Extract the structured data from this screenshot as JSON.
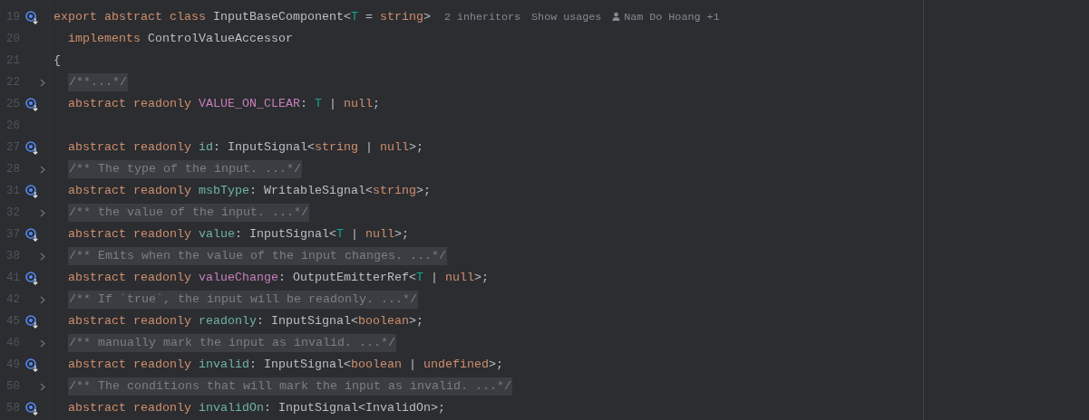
{
  "editor": {
    "lines": [
      {
        "number": "19",
        "marker": {
          "kind": "implemented"
        },
        "kind": "code",
        "indented": false,
        "tokens": [
          {
            "text": "export abstract class ",
            "kind": "kw"
          },
          {
            "text": "InputBaseComponent<",
            "kind": "plain"
          },
          {
            "text": "T",
            "kind": "tparam"
          },
          {
            "text": " = ",
            "kind": "plain"
          },
          {
            "text": "string",
            "kind": "kw"
          },
          {
            "text": ">",
            "kind": "plain"
          }
        ],
        "hints": [
          {
            "text": "2 inheritors",
            "kind": "text"
          },
          {
            "text": "Show usages",
            "kind": "link"
          },
          {
            "text": "Nam Do Hoang +1",
            "kind": "author"
          }
        ]
      },
      {
        "number": "20",
        "kind": "code",
        "indented": true,
        "tokens": [
          {
            "text": "implements ",
            "kind": "kw"
          },
          {
            "text": "ControlValueAccessor",
            "kind": "plain"
          }
        ]
      },
      {
        "number": "21",
        "kind": "code",
        "indented": false,
        "tokens": [
          {
            "text": "{",
            "kind": "plain"
          }
        ]
      },
      {
        "number": "22",
        "marker": {
          "kind": "fold"
        },
        "kind": "folded",
        "indented": true,
        "text": "/**...*/"
      },
      {
        "number": "25",
        "marker": {
          "kind": "implemented"
        },
        "kind": "code",
        "indented": true,
        "tokens": [
          {
            "text": "abstract readonly ",
            "kind": "kw"
          },
          {
            "text": "VALUE_ON_CLEAR",
            "kind": "field"
          },
          {
            "text": ": ",
            "kind": "plain"
          },
          {
            "text": "T",
            "kind": "tparam"
          },
          {
            "text": " | ",
            "kind": "plain"
          },
          {
            "text": "null",
            "kind": "kw"
          },
          {
            "text": ";",
            "kind": "plain"
          }
        ]
      },
      {
        "number": "26",
        "kind": "blank"
      },
      {
        "number": "27",
        "marker": {
          "kind": "implemented"
        },
        "kind": "code",
        "indented": true,
        "tokens": [
          {
            "text": "abstract readonly ",
            "kind": "kw"
          },
          {
            "text": "id",
            "kind": "member"
          },
          {
            "text": ": InputSignal<",
            "kind": "plain"
          },
          {
            "text": "string",
            "kind": "kw"
          },
          {
            "text": " | ",
            "kind": "plain"
          },
          {
            "text": "null",
            "kind": "kw"
          },
          {
            "text": ">;",
            "kind": "plain"
          }
        ]
      },
      {
        "number": "28",
        "marker": {
          "kind": "fold"
        },
        "kind": "folded",
        "indented": true,
        "text": "/** The type of the input. ...*/"
      },
      {
        "number": "31",
        "marker": {
          "kind": "implemented"
        },
        "kind": "code",
        "indented": true,
        "tokens": [
          {
            "text": "abstract readonly ",
            "kind": "kw"
          },
          {
            "text": "msbType",
            "kind": "member"
          },
          {
            "text": ": WritableSignal<",
            "kind": "plain"
          },
          {
            "text": "string",
            "kind": "kw"
          },
          {
            "text": ">;",
            "kind": "plain"
          }
        ]
      },
      {
        "number": "32",
        "marker": {
          "kind": "fold"
        },
        "kind": "folded",
        "indented": true,
        "text": "/** the value of the input. ...*/"
      },
      {
        "number": "37",
        "marker": {
          "kind": "implemented"
        },
        "kind": "code",
        "indented": true,
        "tokens": [
          {
            "text": "abstract readonly ",
            "kind": "kw"
          },
          {
            "text": "value",
            "kind": "member"
          },
          {
            "text": ": InputSignal<",
            "kind": "plain"
          },
          {
            "text": "T",
            "kind": "tparam"
          },
          {
            "text": " | ",
            "kind": "plain"
          },
          {
            "text": "null",
            "kind": "kw"
          },
          {
            "text": ">;",
            "kind": "plain"
          }
        ]
      },
      {
        "number": "38",
        "marker": {
          "kind": "fold"
        },
        "kind": "folded",
        "indented": true,
        "text": "/** Emits when the value of the input changes. ...*/"
      },
      {
        "number": "41",
        "marker": {
          "kind": "implemented"
        },
        "kind": "code",
        "indented": true,
        "tokens": [
          {
            "text": "abstract readonly ",
            "kind": "kw"
          },
          {
            "text": "valueChange",
            "kind": "field"
          },
          {
            "text": ": OutputEmitterRef<",
            "kind": "plain"
          },
          {
            "text": "T",
            "kind": "tparam"
          },
          {
            "text": " | ",
            "kind": "plain"
          },
          {
            "text": "null",
            "kind": "kw"
          },
          {
            "text": ">;",
            "kind": "plain"
          }
        ]
      },
      {
        "number": "42",
        "marker": {
          "kind": "fold"
        },
        "kind": "folded",
        "indented": true,
        "text": "/** If `true`, the input will be readonly. ...*/"
      },
      {
        "number": "45",
        "marker": {
          "kind": "implemented"
        },
        "kind": "code",
        "indented": true,
        "tokens": [
          {
            "text": "abstract readonly ",
            "kind": "kw"
          },
          {
            "text": "readonly",
            "kind": "member"
          },
          {
            "text": ": InputSignal<",
            "kind": "plain"
          },
          {
            "text": "boolean",
            "kind": "kw"
          },
          {
            "text": ">;",
            "kind": "plain"
          }
        ]
      },
      {
        "number": "46",
        "marker": {
          "kind": "fold"
        },
        "kind": "folded",
        "indented": true,
        "text": "/** manually mark the input as invalid. ...*/"
      },
      {
        "number": "49",
        "marker": {
          "kind": "implemented"
        },
        "kind": "code",
        "indented": true,
        "tokens": [
          {
            "text": "abstract readonly ",
            "kind": "kw"
          },
          {
            "text": "invalid",
            "kind": "member"
          },
          {
            "text": ": InputSignal<",
            "kind": "plain"
          },
          {
            "text": "boolean",
            "kind": "kw"
          },
          {
            "text": " | ",
            "kind": "plain"
          },
          {
            "text": "undefined",
            "kind": "kw"
          },
          {
            "text": ">;",
            "kind": "plain"
          }
        ]
      },
      {
        "number": "50",
        "marker": {
          "kind": "fold"
        },
        "kind": "folded",
        "indented": true,
        "text": "/** The conditions that will mark the input as invalid. ...*/"
      },
      {
        "number": "58",
        "marker": {
          "kind": "implemented"
        },
        "kind": "code",
        "indented": true,
        "tokens": [
          {
            "text": "abstract readonly ",
            "kind": "kw"
          },
          {
            "text": "invalidOn",
            "kind": "member"
          },
          {
            "text": ": InputSignal<InvalidOn>;",
            "kind": "plain"
          }
        ]
      }
    ]
  }
}
